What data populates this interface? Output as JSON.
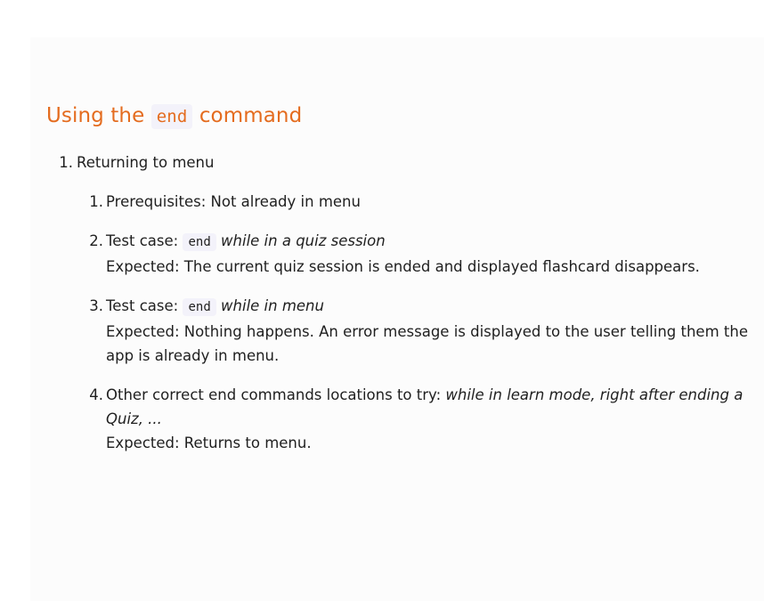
{
  "heading": {
    "prefix": "Using the",
    "code": "end",
    "suffix": "command"
  },
  "outer_item": {
    "number": "1.",
    "label": "Returning to menu"
  },
  "steps": [
    {
      "number": "1.",
      "text": "Prerequisites: Not already in menu"
    },
    {
      "number": "2.",
      "prefix": "Test case:",
      "code": "end",
      "italic": "while in a quiz session",
      "expected": "Expected: The current quiz session is ended and displayed flashcard disappears."
    },
    {
      "number": "3.",
      "prefix": "Test case:",
      "code": "end",
      "italic": "while in menu",
      "expected": "Expected: Nothing happens. An error message is displayed to the user telling them the app is already in menu."
    },
    {
      "number": "4.",
      "prefix": "Other correct end commands locations to try:",
      "italic": "while in learn mode, right after ending a Quiz, ...",
      "expected": "Expected: Returns to menu."
    }
  ]
}
